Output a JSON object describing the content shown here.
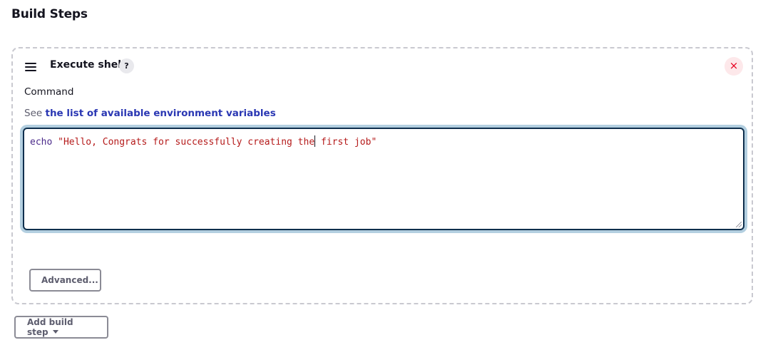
{
  "section": {
    "title": "Build Steps"
  },
  "step": {
    "title": "Execute shell",
    "help_icon": "?",
    "close_icon": "×",
    "command_label": "Command",
    "helper_prefix": "See",
    "helper_link": "the list of available environment variables",
    "command": {
      "keyword": "echo",
      "string_before_caret": "\"Hello, Congrats for successfully creating the",
      "string_after_caret": " first job\""
    },
    "advanced_button": "Advanced..."
  },
  "add_step_button": "Add build step",
  "colors": {
    "link": "#2a37b3",
    "close": "#e6001f",
    "focus_ring": "#b3cfe0",
    "keyword": "#4b2a8a",
    "string": "#b51a1a"
  },
  "icons": {
    "drag_handle": "drag-handle-icon",
    "help": "help-icon",
    "close": "close-icon",
    "dropdown": "chevron-down-icon"
  }
}
